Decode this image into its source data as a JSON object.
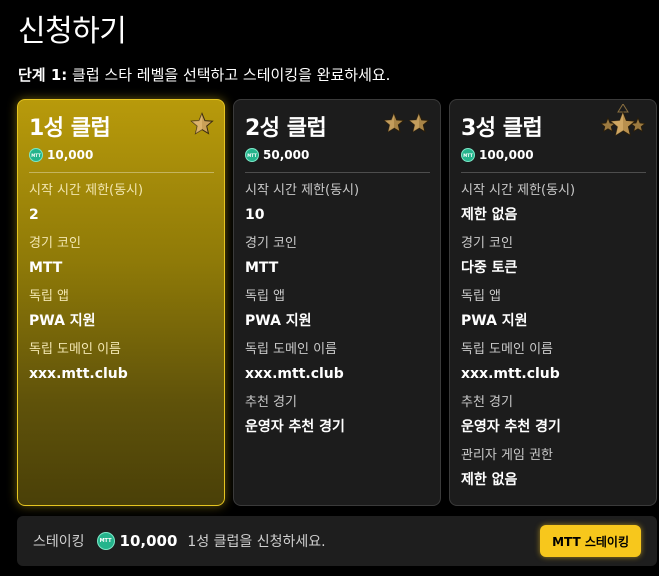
{
  "page": {
    "title": "신청하기",
    "instruction_step": "단계 1:",
    "instruction_text": " 클럽 스타 레벨을 선택하고 스테이킹을 완료하세요."
  },
  "coin_label": "MTT",
  "labels": {
    "start_time_limit": "시작 시간 제한(동시)",
    "game_coin": "경기 코인",
    "standalone_app": "독립 앱",
    "standalone_domain": "독립 도메인 이름",
    "recommended_game": "추천 경기",
    "admin_game_permission": "관리자 게임 권한"
  },
  "clubs": [
    {
      "title": "1성 클럽",
      "price": "10,000",
      "stars": 1,
      "selected": true,
      "features": {
        "start_time_limit": "2",
        "game_coin": "MTT",
        "standalone_app": "PWA 지원",
        "standalone_domain": "xxx.mtt.club"
      }
    },
    {
      "title": "2성 클럽",
      "price": "50,000",
      "stars": 2,
      "selected": false,
      "features": {
        "start_time_limit": "10",
        "game_coin": "MTT",
        "standalone_app": "PWA 지원",
        "standalone_domain": "xxx.mtt.club",
        "recommended_game": "운영자 추천 경기"
      }
    },
    {
      "title": "3성 클럽",
      "price": "100,000",
      "stars": 3,
      "selected": false,
      "features": {
        "start_time_limit": "제한 없음",
        "game_coin": "다중 토큰",
        "standalone_app": "PWA 지원",
        "standalone_domain": "xxx.mtt.club",
        "recommended_game": "운영자 추천 경기",
        "admin_game_permission": "제한 없음"
      }
    }
  ],
  "bottom": {
    "staking_label": "스테이킹",
    "amount": "10,000",
    "message": "1성 클럽을 신청하세요.",
    "button_label": "MTT 스테이킹"
  },
  "colors": {
    "accent": "#f7c71c",
    "selected_card": "#b89a0b",
    "coin": "#25b48c",
    "star": "#c9a24a"
  },
  "icons": {
    "star": "star-icon",
    "coin": "mtt-coin-icon"
  }
}
